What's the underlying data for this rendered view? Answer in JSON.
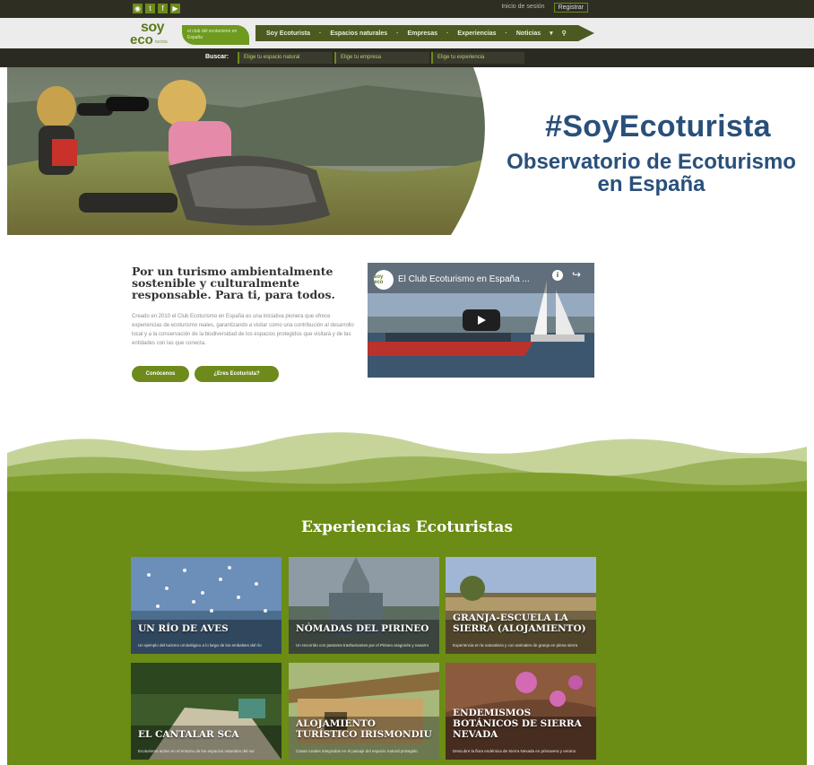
{
  "topbar": {
    "social": [
      "rss",
      "twitter",
      "facebook",
      "youtube"
    ],
    "login_label": "Inicio de sesión",
    "register_label": "Registrar"
  },
  "header": {
    "logo_line1": "soy",
    "logo_line2": "eco",
    "logo_line3": "turista",
    "tagline": "el club del ecoturismo en España",
    "nav": [
      "Soy Ecoturista",
      "Espacios naturales",
      "Empresas",
      "Experiencias",
      "Noticias"
    ],
    "search_icon": "search-icon"
  },
  "subbar": {
    "label": "Buscar:",
    "items": [
      "Elige tu espacio natural",
      "Elige tu empresa",
      "Elige tu experiencia"
    ]
  },
  "hero": {
    "hashtag": "#SoyEcoturista",
    "subtitle": "Observatorio de Ecoturismo en España"
  },
  "intro": {
    "title": "Por un turismo ambientalmente sostenible y culturalmente responsable. Para ti, para todos.",
    "body": "Creado en 2010 el Club Ecoturismo en España es una iniciativa pionera que ofrece experiencias de ecoturismo reales, garantizando a visitar como una contribución al desarrollo local y a la conservación de la biodiversidad de los espacios protegidos que visitará y de las entidades con las que conecta.",
    "btn_primary": "Conócenos",
    "btn_secondary": "¿Eres Ecoturista?"
  },
  "video": {
    "title": "El Club Ecoturismo en España ...",
    "channel_logo": "soy eco"
  },
  "experiences": {
    "heading": "Experiencias Ecoturistas",
    "cards": [
      {
        "title": "Un río de aves",
        "desc": "Un ejemplo del turismo ornitológico a lo largo de los embalses del río"
      },
      {
        "title": "Nómadas del Pirineo",
        "desc": "Un recorrido con pastores trashumantes por el Pirineo aragonés y navarro"
      },
      {
        "title": "Granja-Escuela La Sierra (alojamiento)",
        "desc": "Experiencia en la naturaleza y con animales de granja en plena sierra"
      },
      {
        "title": "El Cantalar SCA",
        "desc": "Ecoturismo activo en el entorno de los espacios naturales del sur"
      },
      {
        "title": "Alojamiento Turístico Irismondiu",
        "desc": "Casas rurales integradas en el paisaje del espacio natural protegido"
      },
      {
        "title": "Endemismos botánicos de Sierra Nevada",
        "desc": "Descubre la flora endémica de Sierra Nevada en primavera y verano"
      }
    ]
  },
  "colors": {
    "brand_green": "#6b8c15",
    "dark_bar": "#2a2a21",
    "hero_text": "#29507a"
  }
}
